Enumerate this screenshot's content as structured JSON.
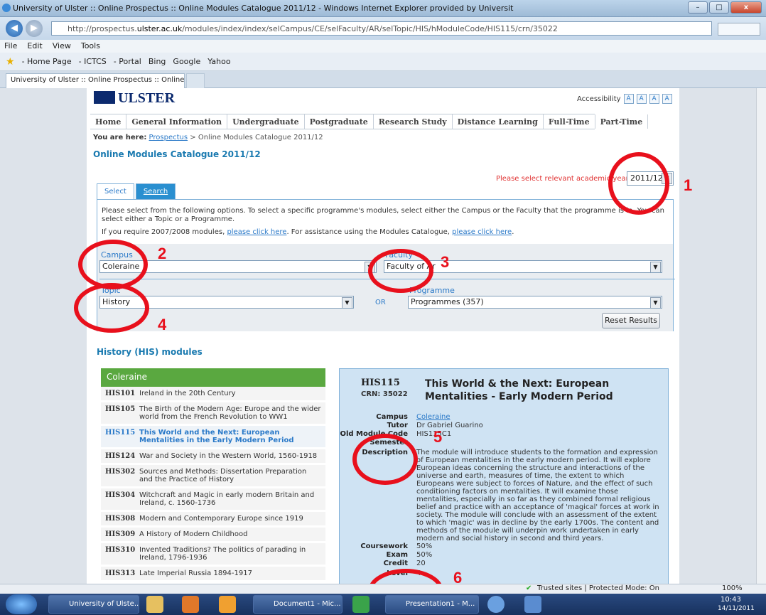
{
  "window": {
    "title": "University of Ulster :: Online Prospectus :: Online Modules Catalogue 2011/12 - Windows Internet Explorer provided by Universit",
    "min": "–",
    "max": "□",
    "close": "x"
  },
  "address": {
    "url_prefix": "http://prospectus.",
    "url_host": "ulster.ac.uk",
    "url_rest": "/modules/index/index/selCampus/CE/selFaculty/AR/selTopic/HIS/hModuleCode/HIS115/crn/35022"
  },
  "menu": [
    "File",
    "Edit",
    "View",
    "Tools"
  ],
  "favorites": [
    "- Home Page",
    "- ICTCS",
    "- Portal",
    "Bing",
    "Google",
    "Yahoo"
  ],
  "browser_tab": "University of Ulster :: Online Prospectus :: Online ...",
  "site": {
    "logo": "ULSTER",
    "accessibility": "Accessibility",
    "acc_buttons": [
      "A",
      "A",
      "A",
      "A"
    ],
    "nav": [
      "Home",
      "General Information",
      "Undergraduate",
      "Postgraduate",
      "Research Study",
      "Distance Learning",
      "Full-Time",
      "Part-Time"
    ],
    "crumb": {
      "label": "You are here:",
      "link": "Prospectus",
      "rest": "> Online Modules Catalogue 2011/12"
    },
    "title": "Online Modules Catalogue 2011/12",
    "year": {
      "label": "Please select relevant academic year:",
      "value": "2011/12"
    },
    "tabs": [
      "Select",
      "Search"
    ],
    "intro": "Please select from the following options. To select a specific programme's modules, select either the Campus or the Faculty that the programme is in. You can select either a Topic or a Programme.",
    "intro2": {
      "a": "If you require 2007/2008 modules,",
      "link1": "please click here",
      "b": ". For assistance using the Modules Catalogue,",
      "link2": "please click here",
      "c": "."
    },
    "filters": {
      "campus_label": "Campus",
      "campus": "Coleraine",
      "faculty_label": "Faculty",
      "faculty": "Faculty of Ar",
      "topic_label": "Topic",
      "topic": "History",
      "programme_label": "Programme",
      "programme": "Programmes (357)",
      "or": "OR"
    },
    "reset": "Reset Results",
    "modules_heading": "History (HIS) modules",
    "list_head": "Coleraine",
    "modules": [
      {
        "code": "HIS101",
        "name": "Ireland in the 20th Century"
      },
      {
        "code": "HIS105",
        "name": "The Birth of the Modern Age: Europe and the wider world from the French Revolution to WW1"
      },
      {
        "code": "HIS115",
        "name": "This World and the Next: European Mentalities in the Early Modern Period"
      },
      {
        "code": "HIS124",
        "name": "War and Society in the Western World, 1560-1918"
      },
      {
        "code": "HIS302",
        "name": "Sources and Methods: Dissertation Preparation and the Practice of History"
      },
      {
        "code": "HIS304",
        "name": "Witchcraft and Magic in early modern Britain and Ireland, c. 1560-1736"
      },
      {
        "code": "HIS308",
        "name": "Modern and Contemporary Europe since 1919"
      },
      {
        "code": "HIS309",
        "name": "A History of Modern Childhood"
      },
      {
        "code": "HIS310",
        "name": "Invented Traditions? The politics of parading in Ireland, 1796-1936"
      },
      {
        "code": "HIS313",
        "name": "Late Imperial Russia 1894-1917"
      }
    ],
    "detail": {
      "code": "HIS115",
      "crn": "CRN: 35022",
      "title": "This World & the Next: European Mentalities - Early Modern Period",
      "campus_k": "Campus",
      "campus_v": "Coleraine",
      "tutor_k": "Tutor",
      "tutor_v": "Dr Gabriel Guarino",
      "old_k": "Old Module Code",
      "old_v": "HIS115C1",
      "semester_k": "Semester",
      "desc_k": "Description",
      "desc_v": "The module will introduce students to the formation and expression of European mentalities in the early modern period. It will explore European ideas concerning the structure and interactions of the universe and earth, measures of time, the extent to which Europeans were subject to forces of Nature, and the effect of such conditioning factors on mentalities. It will examine those mentalities, especially in so far as they combined formal religious belief and practice with an acceptance of 'magical' forces at work in society. The module will conclude with an assessment of the extent to which 'magic' was in decline by the early 1700s. The content and methods of the module will underpin work undertaken in early modern and social history in second and third years.",
      "cw_k": "Coursework",
      "cw_v": "50%",
      "exam_k": "Exam",
      "exam_v": "50%",
      "credit_k": "Credit",
      "credit_v": "20",
      "level_k": "Level",
      "level_v": "4"
    }
  },
  "annotations": [
    "1",
    "2",
    "3",
    "4",
    "5",
    "6"
  ],
  "status": {
    "zone": "Trusted sites | Protected Mode: On",
    "zoom": "100%"
  },
  "taskbar": {
    "buttons": [
      "University of Ulste...",
      "Document1 - Mic...",
      "Presentation1 - M..."
    ],
    "time": "10:43",
    "date": "14/11/2011"
  }
}
